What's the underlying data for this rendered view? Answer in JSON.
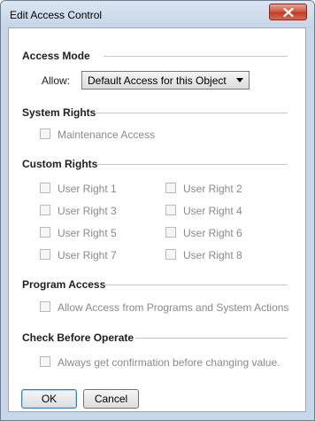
{
  "window": {
    "title": "Edit Access Control"
  },
  "sections": {
    "access_mode": "Access Mode",
    "system_rights": "System Rights",
    "custom_rights": "Custom Rights",
    "program_access": "Program Access",
    "check_before_operate": "Check Before Operate"
  },
  "access_mode": {
    "allow_label": "Allow:",
    "allow_value": "Default Access for this Object"
  },
  "system_rights": {
    "maintenance": "Maintenance Access"
  },
  "custom_rights": {
    "items": [
      "User Right 1",
      "User Right 2",
      "User Right 3",
      "User Right 4",
      "User Right 5",
      "User Right 6",
      "User Right 7",
      "User Right 8"
    ]
  },
  "program_access": {
    "allow_programs": "Allow Access from Programs and System Actions"
  },
  "check_before_operate": {
    "confirm": "Always get confirmation before changing value."
  },
  "buttons": {
    "ok": "OK",
    "cancel": "Cancel"
  },
  "colors": {
    "title_bar": "#c5d5e8",
    "close_button": "#c13c28",
    "disabled_text": "#8a8a8a"
  },
  "icons": {
    "close": "close-x-icon"
  }
}
